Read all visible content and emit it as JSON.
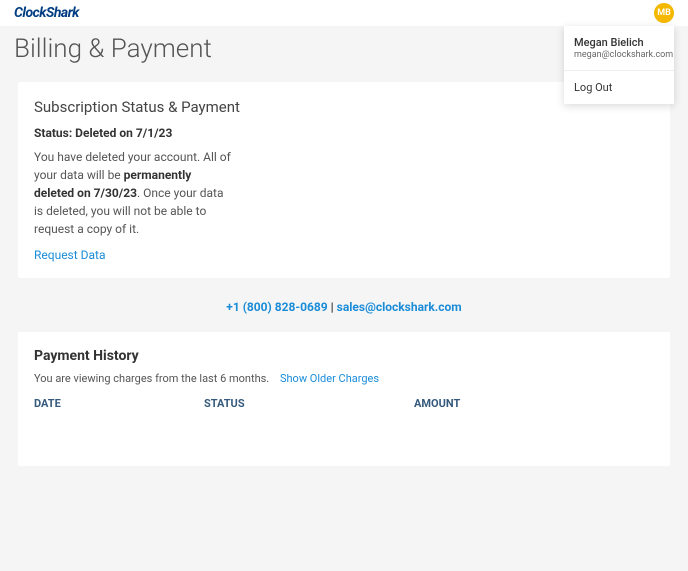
{
  "header": {
    "logo": "ClockShark",
    "avatar_initials": "MB"
  },
  "dropdown": {
    "name": "Megan Bielich",
    "email": "megan@clockshark.com",
    "logout": "Log Out"
  },
  "page_title": "Billing & Payment",
  "subscription": {
    "title": "Subscription Status & Payment",
    "status_label": "Status: Deleted on 7/1/23",
    "desc_part1": "You have deleted your account. All of your data will be ",
    "desc_bold": "permanently deleted on 7/30/23",
    "desc_part2": ". Once your data is deleted, you will not be able to request a copy of it.",
    "request_link": "Request Data"
  },
  "contact": {
    "phone": "+1 (800) 828-0689",
    "separator": " | ",
    "email": "sales@clockshark.com"
  },
  "history": {
    "title": "Payment History",
    "subtitle": "You are viewing charges from the last 6 months.",
    "show_older": "Show Older Charges",
    "columns": {
      "date": "DATE",
      "status": "STATUS",
      "amount": "AMOUNT"
    }
  }
}
